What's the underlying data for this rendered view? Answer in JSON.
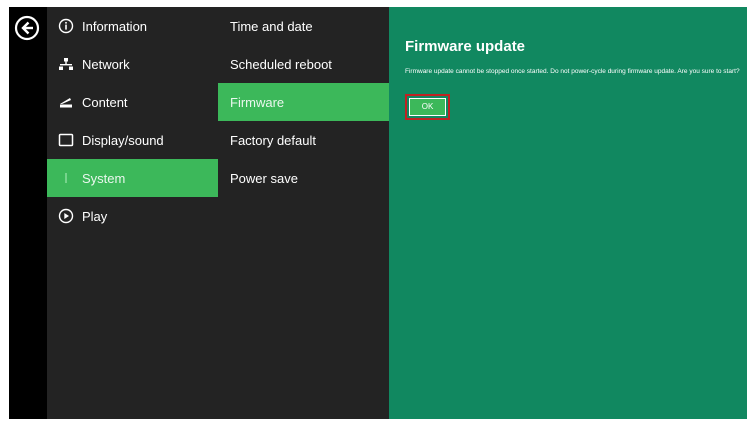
{
  "nav": {
    "back": {
      "icon": "back-arrow-icon"
    },
    "main_items": [
      {
        "label": "Information",
        "icon": "info-icon",
        "active": false
      },
      {
        "label": "Network",
        "icon": "network-icon",
        "active": false
      },
      {
        "label": "Content",
        "icon": "content-icon",
        "active": false
      },
      {
        "label": "Display/sound",
        "icon": "display-icon",
        "active": false
      },
      {
        "label": "System",
        "icon": "system-icon",
        "active": true
      },
      {
        "label": "Play",
        "icon": "play-icon",
        "active": false
      }
    ],
    "sub_items": [
      {
        "label": "Time and date",
        "active": false
      },
      {
        "label": "Scheduled reboot",
        "active": false
      },
      {
        "label": "Firmware",
        "active": true
      },
      {
        "label": "Factory default",
        "active": false
      },
      {
        "label": "Power save",
        "active": false
      }
    ]
  },
  "panel": {
    "title": "Firmware update",
    "message": "Firmware update cannot be stopped once started. Do not power-cycle during firmware update. Are you sure to start?",
    "ok_label": "OK"
  },
  "colors": {
    "accent_green": "#3cb85a",
    "panel_green": "#118860",
    "menu_background": "#232323",
    "highlight_red": "#c02222"
  }
}
